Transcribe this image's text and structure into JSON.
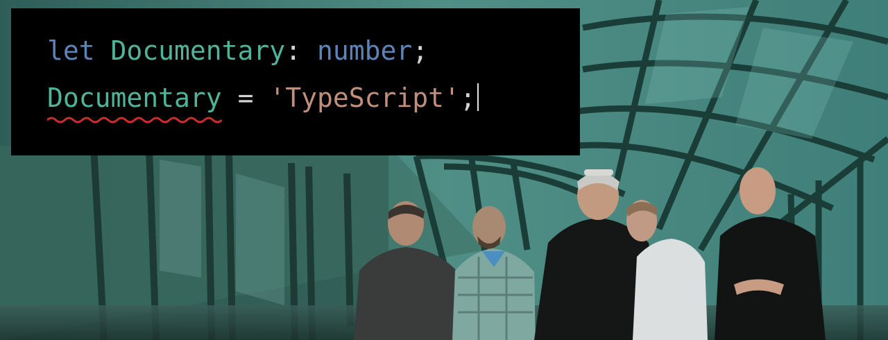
{
  "code": {
    "line1": {
      "keyword": "let",
      "identifier": "Documentary",
      "colon": ":",
      "type": "number",
      "semicolon": ";"
    },
    "line2": {
      "identifier": "Documentary",
      "operator": "=",
      "string": "'TypeScript'",
      "semicolon": ";"
    }
  },
  "colors": {
    "keyword": "#5b84b8",
    "identifier": "#4cb59a",
    "string": "#c2907a",
    "error_squiggle": "#d42b2b",
    "panel_background": "#000000"
  },
  "icons": [
    "error-squiggle-icon",
    "text-caret-icon"
  ]
}
